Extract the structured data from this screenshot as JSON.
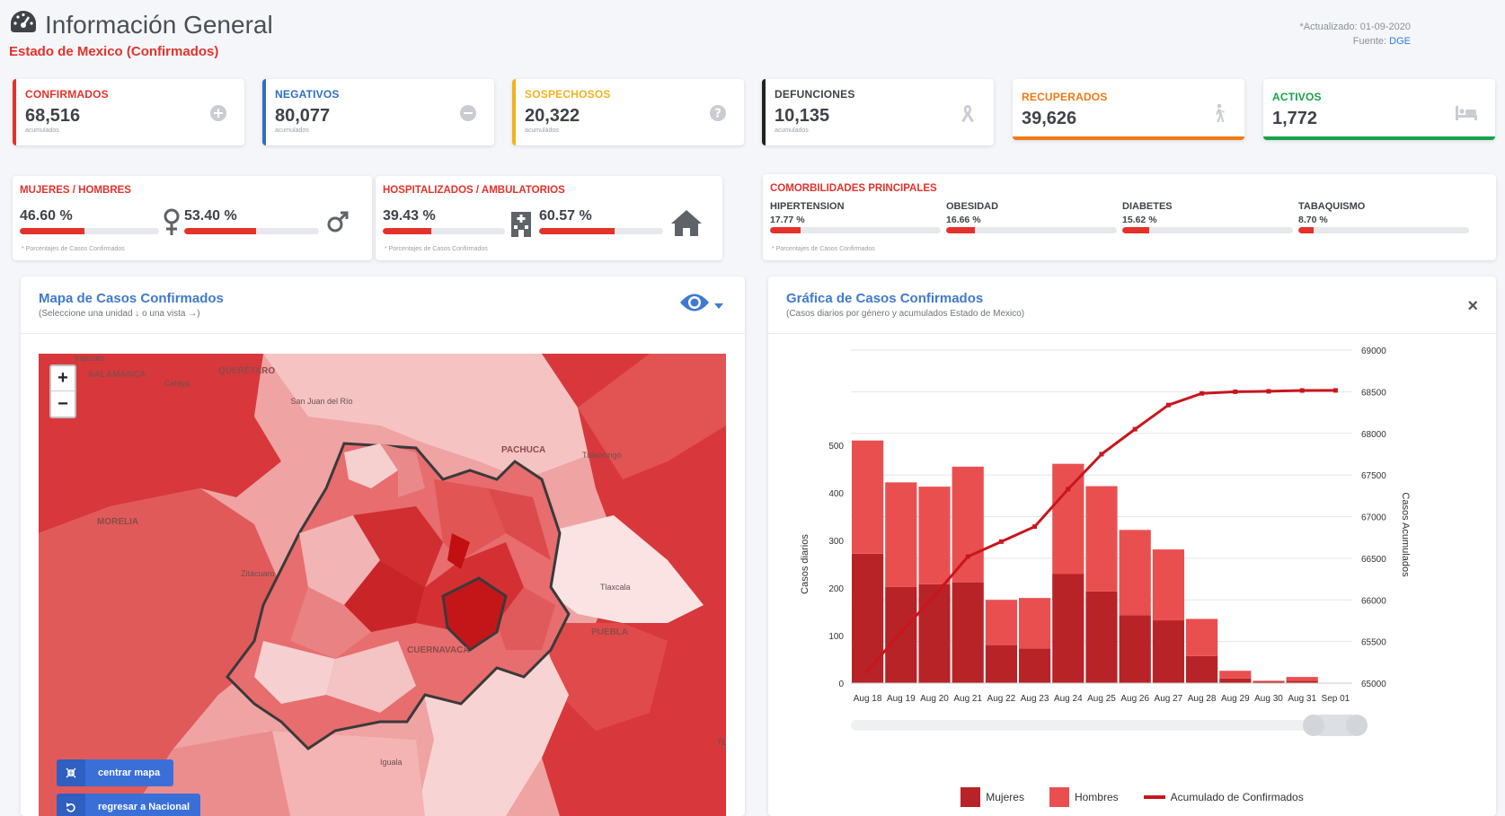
{
  "header": {
    "title": "Información General",
    "subtitle": "Estado de Mexico (Confirmados)",
    "updated": "*Actualizado: 01-09-2020",
    "source_prefix": "Fuente: ",
    "source": "DGE"
  },
  "stats": [
    {
      "label": "CONFIRMADOS",
      "value": "68,516",
      "note": "acumulados",
      "color": "#e4322b",
      "icon": "plus-circle-icon"
    },
    {
      "label": "NEGATIVOS",
      "value": "80,077",
      "note": "acumulados",
      "color": "#2c6fc5",
      "icon": "minus-circle-icon"
    },
    {
      "label": "SOSPECHOSOS",
      "value": "20,322",
      "note": "acumulados",
      "color": "#f2b21c",
      "icon": "question-circle-icon"
    },
    {
      "label": "DEFUNCIONES",
      "value": "10,135",
      "note": "acumulados",
      "color": "#222222",
      "icon": "ribbon-icon"
    },
    {
      "label": "RECUPERADOS",
      "value": "39,626",
      "note": "",
      "color": "#f07a16",
      "icon": "walking-icon"
    },
    {
      "label": "ACTIVOS",
      "value": "1,772",
      "note": "",
      "color": "#16a34a",
      "icon": "bed-icon"
    }
  ],
  "gender": {
    "label": "MUJERES / HOMBRES",
    "women_pct": "46.60 %",
    "women_value": 46.6,
    "men_pct": "53.40 %",
    "men_value": 53.4,
    "foot": "* Porcentajes  de Casos Confirmados"
  },
  "hosp": {
    "label": "HOSPITALIZADOS / AMBULATORIOS",
    "hosp_pct": "39.43 %",
    "hosp_value": 39.43,
    "amb_pct": "60.57 %",
    "amb_value": 60.57,
    "foot": "* Porcentajes  de Casos Confirmados"
  },
  "comorb": {
    "label": "COMORBILIDADES PRINCIPALES",
    "items": [
      {
        "name": "HIPERTENSION",
        "pct": "17.77 %",
        "value": 17.77
      },
      {
        "name": "OBESIDAD",
        "pct": "16.66 %",
        "value": 16.66
      },
      {
        "name": "DIABETES",
        "pct": "15.62 %",
        "value": 15.62
      },
      {
        "name": "TABAQUISMO",
        "pct": "8.70 %",
        "value": 8.7
      }
    ],
    "foot": "* Porcentajes  de Casos Confirmados"
  },
  "map_panel": {
    "title": "Mapa de Casos Confirmados",
    "subtitle": "(Seleccione una unidad ↓ o una vista →)",
    "zoom_in": "+",
    "zoom_out": "−",
    "center_btn": "centrar mapa",
    "back_btn": "regresar a Nacional",
    "places": [
      "Irapuato",
      "SALAMANCA",
      "Celaya",
      "QUERÉTARO",
      "San Juan del Río",
      "PACHUCA",
      "Tulancingo",
      "MORELIA",
      "Zitácuaro",
      "Tlaxcala",
      "PUEBLA",
      "CUERNAVACA",
      "Iguala",
      "TE"
    ]
  },
  "chart_panel": {
    "title": "Gráfica de Casos Confirmados",
    "subtitle": "(Casos diarios por género y acumulados Estado de Mexico)",
    "close": "×"
  },
  "chart_data": {
    "type": "bar",
    "categories": [
      "Aug 18",
      "Aug 19",
      "Aug 20",
      "Aug 21",
      "Aug 22",
      "Aug 23",
      "Aug 24",
      "Aug 25",
      "Aug 26",
      "Aug 27",
      "Aug 28",
      "Aug 29",
      "Aug 30",
      "Aug 31",
      "Sep 01"
    ],
    "series": [
      {
        "name": "Mujeres",
        "type": "bar",
        "stack": "daily",
        "color": "#b82327",
        "values": [
          272,
          202,
          208,
          212,
          80,
          73,
          230,
          193,
          143,
          132,
          57,
          10,
          3,
          5,
          0
        ]
      },
      {
        "name": "Hombres",
        "type": "bar",
        "stack": "daily",
        "color": "#ea4f50",
        "values": [
          238,
          220,
          205,
          243,
          95,
          106,
          231,
          221,
          179,
          149,
          78,
          16,
          2,
          8,
          0
        ]
      },
      {
        "name": "Acumulado de Confirmados",
        "type": "line",
        "axis": "right",
        "color": "#c8161d",
        "values": [
          65150,
          65610,
          66050,
          66520,
          66700,
          66880,
          67330,
          67750,
          68050,
          68340,
          68480,
          68500,
          68505,
          68515,
          68516
        ]
      }
    ],
    "ylabel": "Casos diarios",
    "ylabel_right": "Casos Acumulados",
    "ylim": [
      0,
      500
    ],
    "ylim_right": [
      65000,
      69000
    ],
    "yticks": [
      0,
      100,
      200,
      300,
      400,
      500
    ],
    "yticks_right": [
      65000,
      65500,
      66000,
      66500,
      67000,
      67500,
      68000,
      68500,
      69000
    ],
    "legend": "bottom"
  }
}
